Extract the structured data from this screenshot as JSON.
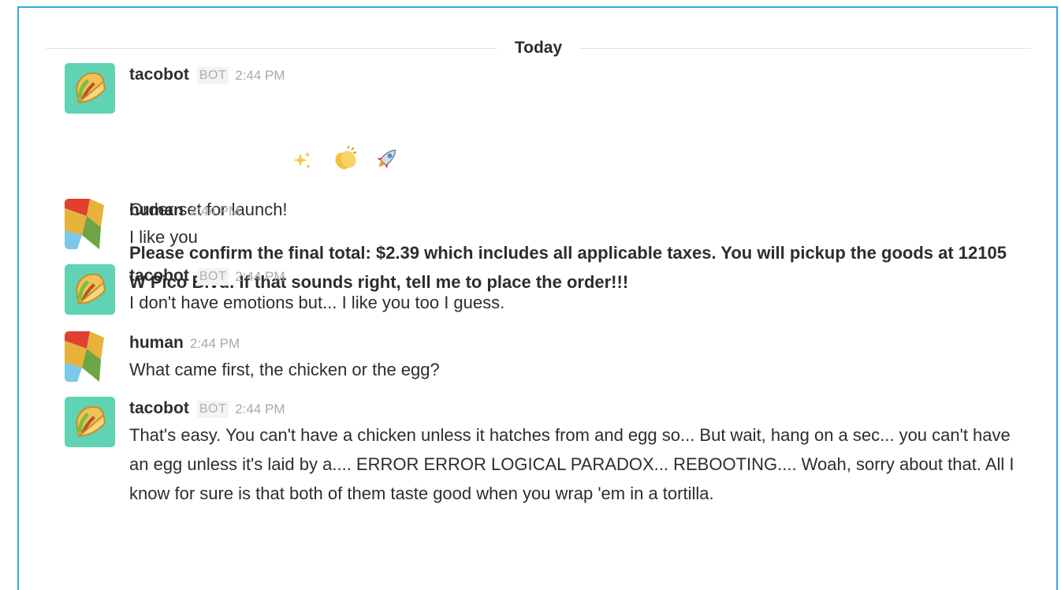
{
  "divider": {
    "label": "Today"
  },
  "messages": [
    {
      "sender": "tacobot",
      "badge": "BOT",
      "time": "2:44 PM",
      "lines": [
        "Order set for launch!"
      ],
      "emoji": [
        "sparkles-icon",
        "clapping-hands-icon",
        "rocket-icon"
      ],
      "attachment": "Please confirm the final total: $2.39 which includes all applicable taxes. You will pickup the goods at 12105 W Pico Blvd. If that sounds right, tell me to place the order!!!"
    },
    {
      "sender": "human",
      "time": "2:44 PM",
      "text": "I like you"
    },
    {
      "sender": "tacobot",
      "badge": "BOT",
      "time": "2:44 PM",
      "text": "I don't have emotions but... I like you too I guess."
    },
    {
      "sender": "human",
      "time": "2:44 PM",
      "text": "What came first, the chicken or the egg?"
    },
    {
      "sender": "tacobot",
      "badge": "BOT",
      "time": "2:44 PM",
      "text": "That's easy. You can't have a chicken unless it hatches from and egg so... But wait, hang on a sec... you can't have an egg unless it's laid by a.... ERROR ERROR LOGICAL PARADOX... REBOOTING.... Woah, sorry about that. All I know for sure is that both of them taste good when you wrap 'em in a tortilla."
    }
  ],
  "colors": {
    "frame_border": "#35a8e0",
    "bot_avatar_bg": "#5fd3b4",
    "human_avatar_red": "#e0402f",
    "human_avatar_yellow": "#e8b23a",
    "human_avatar_green": "#6ea544",
    "human_avatar_blue": "#7cc8e8"
  }
}
